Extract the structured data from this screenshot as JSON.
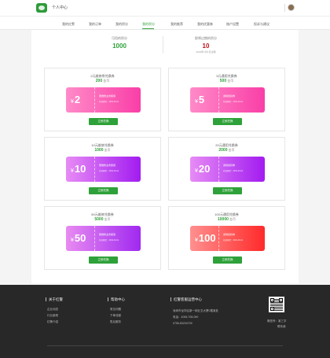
{
  "header": {
    "separator": "·",
    "title": "个人中心"
  },
  "nav": {
    "items": [
      {
        "label": "我的红警"
      },
      {
        "label": "我的订单"
      },
      {
        "label": "我的积分"
      },
      {
        "label": "我的积分"
      },
      {
        "label": "我的推荐"
      },
      {
        "label": "我的优惠券"
      },
      {
        "label": "账户设置"
      },
      {
        "label": "投诉与建议"
      }
    ],
    "active_index": 3
  },
  "points": {
    "available_label": "可用的积分",
    "available_value": "1000",
    "expiring_label": "即将过期的积分",
    "expiring_value": "10",
    "expiring_note": "2019年1月1日过期"
  },
  "coupons": [
    {
      "title": "2元维修劵兑换券",
      "points": "200",
      "unit": "金币",
      "amount": "2",
      "desc": "限维修业务使用",
      "date": "有效期至：2019-03-01",
      "btn": "立即兑换",
      "from": "#ff8ac8",
      "to": "#f93fa7"
    },
    {
      "title": "5元通用兑换券",
      "points": "500",
      "unit": "金币",
      "amount": "5",
      "desc": "通用抵扣券",
      "date": "有效期至：2019-03-01",
      "btn": "立即兑换",
      "from": "#ff8ac8",
      "to": "#f93fa7"
    },
    {
      "title": "10元维修兑换券",
      "points": "1000",
      "unit": "金币",
      "amount": "10",
      "desc": "限维修业务使用",
      "date": "有效期至：2019-03-01",
      "btn": "立即兑换",
      "from": "#e78bf5",
      "to": "#a21cf0"
    },
    {
      "title": "20元通用兑换券",
      "points": "2000",
      "unit": "金币",
      "amount": "20",
      "desc": "通用抵扣券",
      "date": "有效期至：2019-03-01",
      "btn": "立即兑换",
      "from": "#e78bf5",
      "to": "#a21cf0"
    },
    {
      "title": "50元维修兑换券",
      "points": "5000",
      "unit": "金币",
      "amount": "50",
      "desc": "限维修业务使用",
      "date": "有效期至：2019-03-01",
      "btn": "立即兑换",
      "from": "#e88bf1",
      "to": "#a029f0"
    },
    {
      "title": "100元通用兑换券",
      "points": "10000",
      "unit": "金币",
      "amount": "100",
      "desc": "通用抵扣券",
      "date": "有效期至：2019-03-01",
      "btn": "立即兑换",
      "from": "#ff8f8f",
      "to": "#ff2a2a"
    }
  ],
  "footer": {
    "about_title": "关于红警",
    "about_links": [
      "企业动态",
      "行业新闻",
      "红警介绍"
    ],
    "help_title": "帮助中心",
    "help_links": [
      "常见问题",
      "下单流程",
      "售后服务"
    ],
    "service_title": "红警客服运营中心",
    "address": "深圳市龙华区新一网业文大厦0楼某处",
    "phone": "电话：4006-708-090",
    "tel": "0755-83234739",
    "qr_caption": "微信号：某三字",
    "qr_caption2": "联系我"
  }
}
